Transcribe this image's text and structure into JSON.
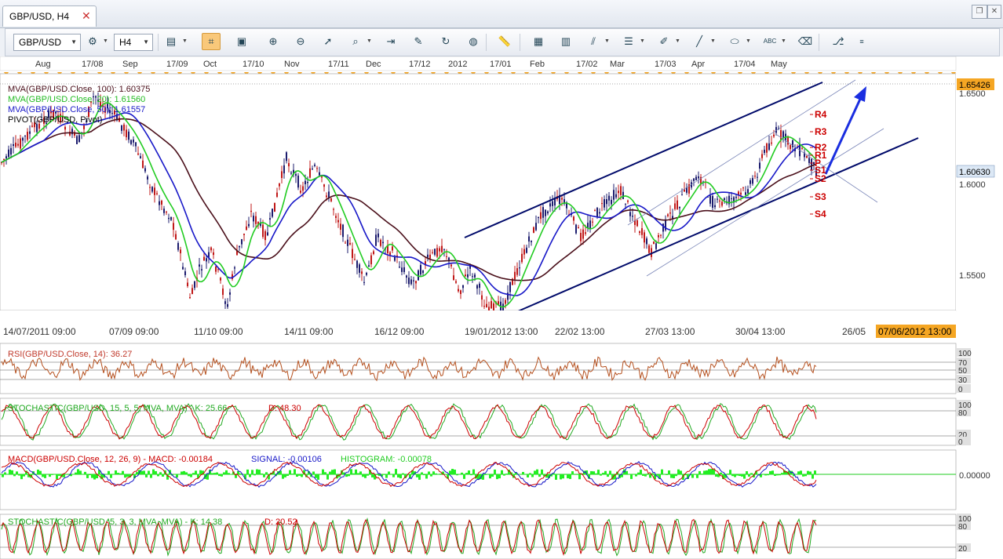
{
  "window": {
    "tab_title": "GBP/USD, H4",
    "tab_close": "✕"
  },
  "toolbar": {
    "symbol": "GBP/USD",
    "timeframe": "H4"
  },
  "top_dates": [
    "Aug",
    "17/08",
    "Sep",
    "17/09",
    "Oct",
    "17/10",
    "Nov",
    "17/11",
    "Dec",
    "17/12",
    "2012",
    "17/01",
    "Feb",
    "17/02",
    "Mar",
    "17/03",
    "Apr",
    "17/04",
    "May"
  ],
  "bottom_dates": [
    "14/07/2011 09:00",
    "07/09 09:00",
    "11/10 09:00",
    "14/11 09:00",
    "16/12 09:00",
    "19/01/2012 13:00",
    "22/02 13:00",
    "27/03 13:00",
    "30/04 13:00",
    "26/05"
  ],
  "crosshair_date": "07/06/2012 13:00",
  "price_axis": {
    "ticks": [
      "1.6500",
      "1.6000",
      "1.5500"
    ],
    "current": "1.60630",
    "top_marker": "1.65426"
  },
  "legend": {
    "ma100": "MVA(GBP/USD.Close, 100): 1.60375",
    "ma20": "MVA(GBP/USD.Close, 20): 1.61560",
    "ma50": "MVA(GBP/USD.Close, 50): 1.61557",
    "pivot": "PIVOT(GBP/USD, Pivot)"
  },
  "pivots": [
    "R4",
    "R3",
    "R2",
    "R1",
    "P",
    "S1",
    "S2",
    "S3",
    "S4"
  ],
  "panels": {
    "rsi": {
      "label": "RSI(GBP/USD.Close, 14): 36.27",
      "ticks": [
        "100",
        "70",
        "50",
        "30",
        "0"
      ]
    },
    "stoch1": {
      "label": "STOCHASTIC(GBP/USD, 15, 5, 5, MVA, MVA) -  K: 25.66",
      "d": "D: 48.30",
      "ticks": [
        "100",
        "80",
        "20",
        "0"
      ]
    },
    "macd": {
      "label": "MACD(GBP/USD.Close, 12, 26, 9) -  MACD: -0.00184",
      "signal": "SIGNAL: -0.00106",
      "hist": "HISTOGRAM: -0.00078",
      "ticks": [
        "0.00000"
      ]
    },
    "stoch2": {
      "label": "STOCHASTIC(GBP/USD, 5, 3, 3, MVA, MVA) -  K: 14.38",
      "d": "D: 20.52",
      "ticks": [
        "100",
        "80",
        "20"
      ]
    }
  },
  "colors": {
    "ma100": "#4a0f1a",
    "ma20": "#22cc22",
    "ma50": "#1818c8",
    "candle_up": "#1c1c6e",
    "candle_down": "#c01818",
    "pivot": "#cc0000",
    "channel": "#000a6a",
    "arrow": "#1a2ee0",
    "axis_highlight": "#f5a623"
  },
  "icons": [
    "indicators-icon",
    "crosshair-icon",
    "zoom-in-icon",
    "zoom-out-icon",
    "pointer-icon",
    "properties-icon",
    "period-separator-icon",
    "insert-object-icon",
    "refresh-icon",
    "globe-icon",
    "ruler-icon",
    "save-image-icon",
    "template-icon",
    "fibonacci-icon",
    "horizontal-line-icon",
    "pencil-icon",
    "trend-line-icon",
    "ellipse-icon",
    "text-label-icon",
    "eraser-icon",
    "tree-icon",
    "more-icon"
  ]
}
